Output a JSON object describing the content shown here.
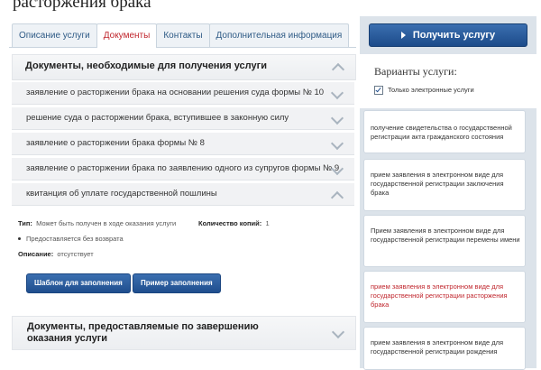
{
  "page": {
    "title": "расторжения брака"
  },
  "tabs": [
    "Описание услуги",
    "Документы",
    "Контакты",
    "Дополнительная информация"
  ],
  "documents": {
    "section_title": "Документы, необходимые для получения услуги",
    "items": [
      "заявление о расторжении брака на основании решения суда формы № 10",
      "решение суда о расторжении брака, вступившее в законную силу",
      "заявление о расторжении брака формы № 8",
      "заявление о расторжении брака по заявлению одного из супругов формы № 9",
      "квитанция об уплате государственной пошлины"
    ],
    "details": {
      "type_label": "Тип:",
      "type_value": "Может быть получен в ходе оказания услуги",
      "copies_label": "Количество копий:",
      "copies_value": "1",
      "bullet": "Предоставляется без возврата",
      "desc_label": "Описание:",
      "desc_value": "отсутствует",
      "template_button": "Шаблон для заполнения",
      "example_button": "Пример заполнения"
    }
  },
  "section2": {
    "title": "Документы, предоставляемые по завершению оказания услуги"
  },
  "sidebar": {
    "get_button": "Получить услугу",
    "variants_title": "Варианты услуги:",
    "checkbox_label": "Только электронные услуги",
    "checkbox_checked": true,
    "services": [
      "получение свидетельства о государственной регистрации акта гражданского состояния",
      "прием заявления в электронном виде для государственной регистрации заключения брака",
      "Прием заявления в электронном виде для государственной регистрации перемены имени",
      "прием заявления в электронном виде для государственной регистрации расторжения брака",
      "прием заявления в электронном виде для государственной регистрации рождения"
    ],
    "active_service_index": 3
  },
  "colors": {
    "accent_red": "#c0262d",
    "button_blue": "#1f4e8e",
    "link_blue": "#2f5b86"
  }
}
